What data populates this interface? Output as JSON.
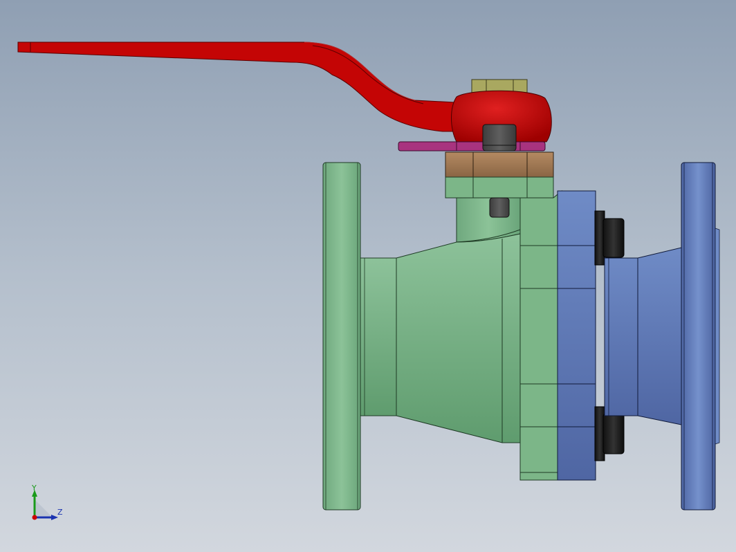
{
  "view": {
    "background_top": "#8f9fb3",
    "background_bottom": "#d2d7de"
  },
  "model": {
    "parts": [
      {
        "name": "lever-handle",
        "color": "#c00000"
      },
      {
        "name": "stem-nut",
        "color": "#a9a860"
      },
      {
        "name": "stop-plate",
        "color": "#a8337f"
      },
      {
        "name": "gland-flange",
        "color": "#9a7550"
      },
      {
        "name": "valve-body",
        "color": "#7fb48a"
      },
      {
        "name": "end-cap",
        "color": "#6580b8"
      },
      {
        "name": "body-bolts",
        "color": "#1c1c1c"
      }
    ]
  },
  "triad": {
    "y_label": "Y",
    "z_label": "Z",
    "y_color": "#1a9a1a",
    "z_color": "#1a33b0",
    "origin_color": "#cc0000"
  }
}
